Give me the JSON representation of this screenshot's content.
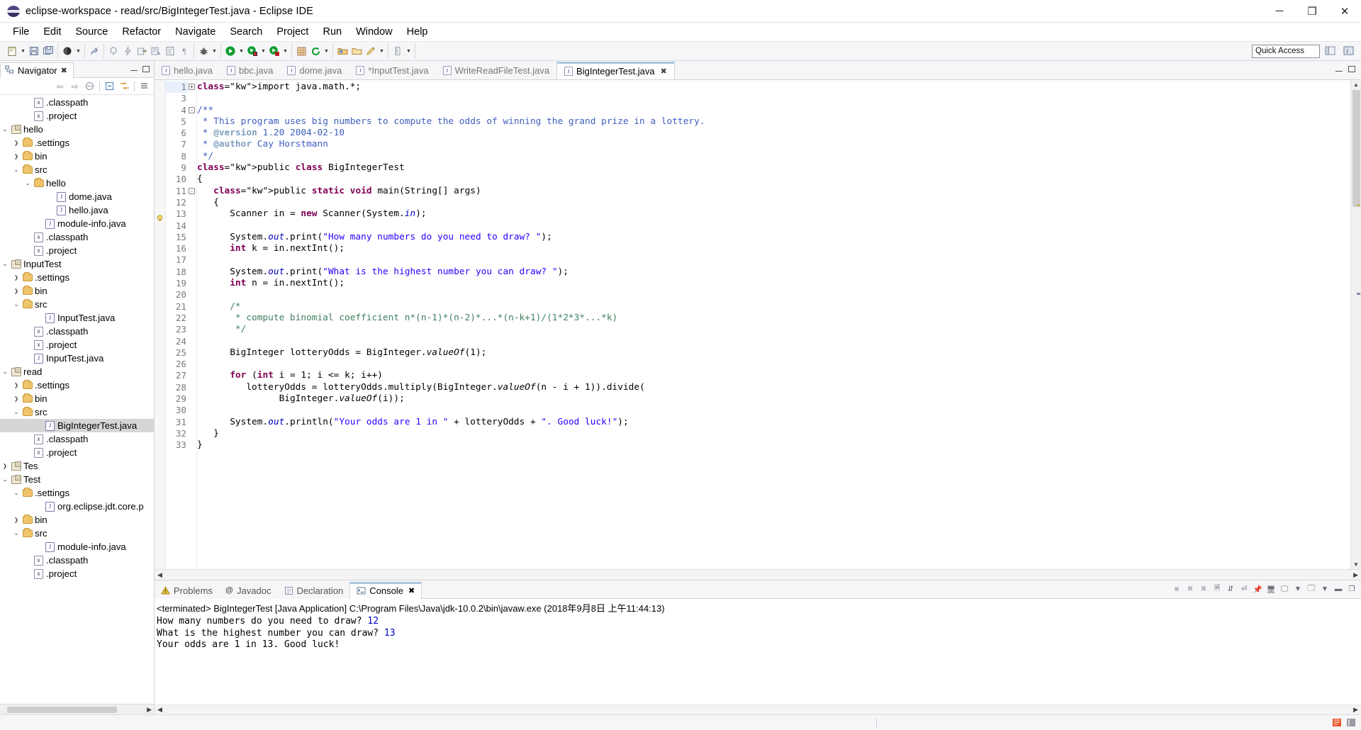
{
  "window": {
    "title": "eclipse-workspace - read/src/BigIntegerTest.java - Eclipse IDE",
    "minimize": "─",
    "maximize": "❐",
    "close": "✕"
  },
  "menubar": [
    "File",
    "Edit",
    "Source",
    "Refactor",
    "Navigate",
    "Search",
    "Project",
    "Run",
    "Window",
    "Help"
  ],
  "toolbar": {
    "quick_access_placeholder": "Quick Access",
    "quick_access_value": "",
    "groups": [
      [
        "new-wizard-icon",
        "new-dropdown",
        "save-icon",
        "save-all-icon"
      ],
      [
        "debug-perspective-icon",
        "debug-dropdown"
      ],
      [
        "link-break-icon"
      ],
      [
        "annotation-icon",
        "lightning-icon",
        "export-icon",
        "build-icon",
        "console-doc-icon",
        "pilcrow-icon"
      ],
      [
        "debug-bug-icon",
        "debug-dropdown-2"
      ],
      [
        "run-icon",
        "run-dropdown",
        "coverage-icon",
        "coverage-dropdown",
        "profile-icon",
        "profile-dropdown"
      ],
      [
        "search-grid-icon",
        "refresh-icon",
        "refresh-dropdown"
      ],
      [
        "open-folder-icon",
        "open-type-icon",
        "edit-pencil-icon",
        "pencil-dropdown"
      ],
      [
        "ruler-icon",
        "ruler-dropdown"
      ]
    ]
  },
  "navigator": {
    "tab_label": "Navigator",
    "tab_close": "✖",
    "toolbar_icons": [
      "back-arrow-icon",
      "forward-arrow-icon",
      "home-icon",
      "collapse-all-icon",
      "link-editor-icon",
      "view-menu-icon"
    ],
    "tree": [
      {
        "indent": 2,
        "twisty": "",
        "icon": "x-file",
        "label": ".classpath"
      },
      {
        "indent": 2,
        "twisty": "",
        "icon": "x-file",
        "label": ".project"
      },
      {
        "indent": 0,
        "twisty": "v",
        "icon": "project",
        "label": "hello"
      },
      {
        "indent": 1,
        "twisty": ">",
        "icon": "folder",
        "label": ".settings"
      },
      {
        "indent": 1,
        "twisty": ">",
        "icon": "folder",
        "label": "bin"
      },
      {
        "indent": 1,
        "twisty": "v",
        "icon": "folder",
        "label": "src"
      },
      {
        "indent": 2,
        "twisty": "v",
        "icon": "folder",
        "label": "hello"
      },
      {
        "indent": 4,
        "twisty": "",
        "icon": "java",
        "label": "dome.java"
      },
      {
        "indent": 4,
        "twisty": "",
        "icon": "java",
        "label": "hello.java"
      },
      {
        "indent": 3,
        "twisty": "",
        "icon": "java",
        "label": "module-info.java"
      },
      {
        "indent": 2,
        "twisty": "",
        "icon": "x-file",
        "label": ".classpath"
      },
      {
        "indent": 2,
        "twisty": "",
        "icon": "x-file",
        "label": ".project"
      },
      {
        "indent": 0,
        "twisty": "v",
        "icon": "project",
        "label": "InputTest"
      },
      {
        "indent": 1,
        "twisty": ">",
        "icon": "folder",
        "label": ".settings"
      },
      {
        "indent": 1,
        "twisty": ">",
        "icon": "folder",
        "label": "bin"
      },
      {
        "indent": 1,
        "twisty": "v",
        "icon": "folder",
        "label": "src"
      },
      {
        "indent": 3,
        "twisty": "",
        "icon": "java",
        "label": "InputTest.java"
      },
      {
        "indent": 2,
        "twisty": "",
        "icon": "x-file",
        "label": ".classpath"
      },
      {
        "indent": 2,
        "twisty": "",
        "icon": "x-file",
        "label": ".project"
      },
      {
        "indent": 2,
        "twisty": "",
        "icon": "java",
        "label": "InputTest.java"
      },
      {
        "indent": 0,
        "twisty": "v",
        "icon": "project",
        "label": "read"
      },
      {
        "indent": 1,
        "twisty": ">",
        "icon": "folder",
        "label": ".settings"
      },
      {
        "indent": 1,
        "twisty": ">",
        "icon": "folder",
        "label": "bin"
      },
      {
        "indent": 1,
        "twisty": "v",
        "icon": "folder",
        "label": "src"
      },
      {
        "indent": 3,
        "twisty": "",
        "icon": "java",
        "label": "BigIntegerTest.java",
        "selected": true
      },
      {
        "indent": 2,
        "twisty": "",
        "icon": "x-file",
        "label": ".classpath"
      },
      {
        "indent": 2,
        "twisty": "",
        "icon": "x-file",
        "label": ".project"
      },
      {
        "indent": 0,
        "twisty": ">",
        "icon": "project",
        "label": "Tes"
      },
      {
        "indent": 0,
        "twisty": "v",
        "icon": "project",
        "label": "Test"
      },
      {
        "indent": 1,
        "twisty": "v",
        "icon": "folder",
        "label": ".settings"
      },
      {
        "indent": 3,
        "twisty": "",
        "icon": "java",
        "label": "org.eclipse.jdt.core.p"
      },
      {
        "indent": 1,
        "twisty": ">",
        "icon": "folder",
        "label": "bin"
      },
      {
        "indent": 1,
        "twisty": "v",
        "icon": "folder",
        "label": "src"
      },
      {
        "indent": 3,
        "twisty": "",
        "icon": "java",
        "label": "module-info.java"
      },
      {
        "indent": 2,
        "twisty": "",
        "icon": "x-file",
        "label": ".classpath"
      },
      {
        "indent": 2,
        "twisty": "",
        "icon": "x-file",
        "label": ".project"
      }
    ]
  },
  "editor": {
    "tabs": [
      {
        "label": "hello.java",
        "active": false,
        "dirty": false
      },
      {
        "label": "bbc.java",
        "active": false,
        "dirty": false
      },
      {
        "label": "dome.java",
        "active": false,
        "dirty": false
      },
      {
        "label": "*InputTest.java",
        "active": false,
        "dirty": true
      },
      {
        "label": "WriteReadFileTest.java",
        "active": false,
        "dirty": false
      },
      {
        "label": "BigIntegerTest.java",
        "active": true,
        "dirty": false,
        "close": "✖"
      }
    ],
    "line_numbers": [
      "1",
      "3",
      "4",
      "5",
      "6",
      "7",
      "8",
      "9",
      "10",
      "11",
      "12",
      "13",
      "14",
      "15",
      "16",
      "17",
      "18",
      "19",
      "20",
      "21",
      "22",
      "23",
      "24",
      "25",
      "26",
      "27",
      "28",
      "29",
      "30",
      "31",
      "32",
      "33"
    ],
    "code_lines": [
      "import java.math.*;",
      "",
      "/**",
      " * This program uses big numbers to compute the odds of winning the grand prize in a lottery.",
      " * @version 1.20 2004-02-10",
      " * @author Cay Horstmann",
      " */",
      "public class BigIntegerTest",
      "{",
      "   public static void main(String[] args)",
      "   {",
      "      Scanner in = new Scanner(System.in);",
      "",
      "      System.out.print(\"How many numbers do you need to draw? \");",
      "      int k = in.nextInt();",
      "",
      "      System.out.print(\"What is the highest number you can draw? \");",
      "      int n = in.nextInt();",
      "",
      "      /*",
      "       * compute binomial coefficient n*(n-1)*(n-2)*...*(n-k+1)/(1*2*3*...*k)",
      "       */",
      "",
      "      BigInteger lotteryOdds = BigInteger.valueOf(1);",
      "",
      "      for (int i = 1; i <= k; i++)",
      "         lotteryOdds = lotteryOdds.multiply(BigInteger.valueOf(n - i + 1)).divide(",
      "               BigInteger.valueOf(i));",
      "",
      "      System.out.println(\"Your odds are 1 in \" + lotteryOdds + \". Good luck!\");",
      "   }",
      "}"
    ]
  },
  "console": {
    "tabs": [
      {
        "label": "Problems",
        "icon": "problems-icon",
        "active": false
      },
      {
        "label": "Javadoc",
        "icon": "javadoc-icon",
        "active": false
      },
      {
        "label": "Declaration",
        "icon": "declaration-icon",
        "active": false
      },
      {
        "label": "Console",
        "icon": "console-icon",
        "active": true,
        "close": "✖"
      }
    ],
    "toolbar_icons": [
      "terminate-icon",
      "remove-launch-icon",
      "remove-all-icon",
      "clear-console-icon",
      "scroll-lock-icon",
      "word-wrap-icon",
      "pin-console-icon",
      "display-selected-icon",
      "open-console-icon",
      "open-console-dropdown",
      "new-console-icon",
      "new-console-dropdown",
      "minimize-icon",
      "maximize-icon"
    ],
    "header": "<terminated> BigIntegerTest [Java Application] C:\\Program Files\\Java\\jdk-10.0.2\\bin\\javaw.exe (2018年9月8日 上午11:44:13)",
    "output": [
      {
        "prompt": "How many numbers do you need to draw? ",
        "input": "12"
      },
      {
        "prompt": "What is the highest number you can draw? ",
        "input": "13"
      },
      {
        "prompt": "Your odds are 1 in 13. Good luck!",
        "input": ""
      }
    ]
  },
  "statusbar": {
    "left": "",
    "right_icons": [
      "writable-icon",
      "insert-mode-icon"
    ]
  },
  "colors": {
    "keyword": "#7f0055",
    "string": "#2a00ff",
    "comment": "#3f7f5f",
    "javadoc": "#3f5fbf",
    "field": "#0000c0",
    "selection": "#d6d6d6",
    "tab_accent": "#a8c6e2"
  }
}
